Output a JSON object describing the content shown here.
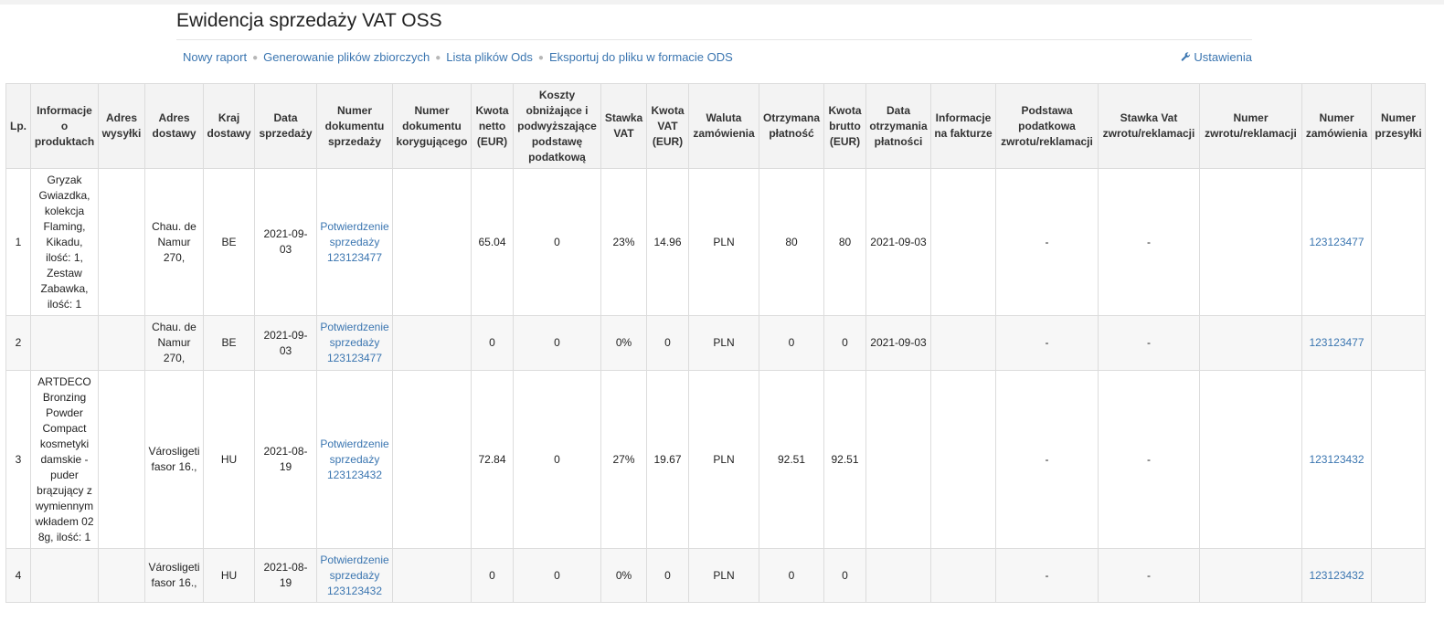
{
  "page": {
    "title": "Ewidencja sprzedaży VAT OSS"
  },
  "nav": {
    "items": [
      "Nowy raport",
      "Generowanie plików zbiorczych",
      "Lista plików Ods",
      "Eksportuj do pliku w formacie ODS"
    ],
    "settings_label": "Ustawienia",
    "settings_icon": "wrench-icon"
  },
  "table": {
    "headers": [
      "Lp.",
      "Informacje o produktach",
      "Adres wysyłki",
      "Adres dostawy",
      "Kraj dostawy",
      "Data sprzedaży",
      "Numer dokumentu sprzedaży",
      "Numer dokumentu korygującego",
      "Kwota netto (EUR)",
      "Koszty obniżające i podwyższające podstawę podatkową",
      "Stawka VAT",
      "Kwota VAT (EUR)",
      "Waluta zamówienia",
      "Otrzymana płatność",
      "Kwota brutto (EUR)",
      "Data otrzymania płatności",
      "Informacje na fakturze",
      "Podstawa podatkowa zwrotu/reklamacji",
      "Stawka Vat zwrotu/reklamacji",
      "Numer zwrotu/reklamacji",
      "Numer zamówienia",
      "Numer przesyłki"
    ],
    "rows": [
      {
        "lp": "1",
        "product": "Gryzak Gwiazdka, kolekcja Flaming, Kikadu, ilość: 1, Zestaw Zabawka, ilość: 1",
        "ship_addr": "",
        "delivery_addr": "Chau. de Namur 270,",
        "country": "BE",
        "sale_date": "2021-09-03",
        "doc_link": "Potwierdzenie sprzedaży 123123477",
        "corr_doc": "",
        "net": "65.04",
        "costs": "0",
        "vat_rate": "23%",
        "vat": "14.96",
        "currency": "PLN",
        "payment": "80",
        "gross": "80",
        "payment_date": "2021-09-03",
        "invoice_info": "",
        "ret_base": "-",
        "ret_rate": "-",
        "ret_no": "",
        "order_no": "123123477",
        "shipment_no": ""
      },
      {
        "lp": "2",
        "product": "",
        "ship_addr": "",
        "delivery_addr": "Chau. de Namur 270,",
        "country": "BE",
        "sale_date": "2021-09-03",
        "doc_link": "Potwierdzenie sprzedaży 123123477",
        "corr_doc": "",
        "net": "0",
        "costs": "0",
        "vat_rate": "0%",
        "vat": "0",
        "currency": "PLN",
        "payment": "0",
        "gross": "0",
        "payment_date": "2021-09-03",
        "invoice_info": "",
        "ret_base": "-",
        "ret_rate": "-",
        "ret_no": "",
        "order_no": "123123477",
        "shipment_no": ""
      },
      {
        "lp": "3",
        "product": "ARTDECO Bronzing Powder Compact kosmetyki damskie - puder brązujący z wymiennym wkładem 02 8g, ilość: 1",
        "ship_addr": "",
        "delivery_addr": "Városligeti fasor 16.,",
        "country": "HU",
        "sale_date": "2021-08-19",
        "doc_link": "Potwierdzenie sprzedaży 123123432",
        "corr_doc": "",
        "net": "72.84",
        "costs": "0",
        "vat_rate": "27%",
        "vat": "19.67",
        "currency": "PLN",
        "payment": "92.51",
        "gross": "92.51",
        "payment_date": "",
        "invoice_info": "",
        "ret_base": "-",
        "ret_rate": "-",
        "ret_no": "",
        "order_no": "123123432",
        "shipment_no": ""
      },
      {
        "lp": "4",
        "product": "",
        "ship_addr": "",
        "delivery_addr": "Városligeti fasor 16.,",
        "country": "HU",
        "sale_date": "2021-08-19",
        "doc_link": "Potwierdzenie sprzedaży 123123432",
        "corr_doc": "",
        "net": "0",
        "costs": "0",
        "vat_rate": "0%",
        "vat": "0",
        "currency": "PLN",
        "payment": "0",
        "gross": "0",
        "payment_date": "",
        "invoice_info": "",
        "ret_base": "-",
        "ret_rate": "-",
        "ret_no": "",
        "order_no": "123123432",
        "shipment_no": ""
      }
    ]
  },
  "colors": {
    "link": "#3a75b0",
    "header_bg": "#f3f3f3",
    "border": "#dcdcdc"
  }
}
